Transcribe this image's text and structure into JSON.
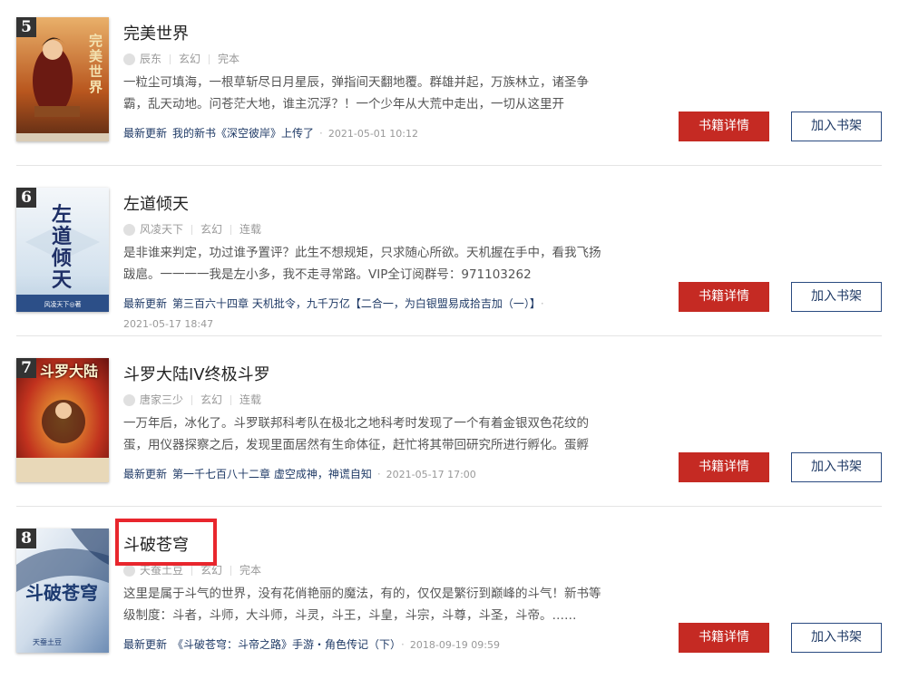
{
  "labels": {
    "update": "最新更新",
    "detail_button": "书籍详情",
    "shelf_button": "加入书架"
  },
  "books": [
    {
      "rank": "5",
      "title": "完美世界",
      "author": "辰东",
      "genre": "玄幻",
      "status": "完本",
      "desc": "一粒尘可填海，一根草斩尽日月星辰，弹指间天翻地覆。群雄并起，万族林立，诸圣争霸，乱天动地。问苍茫大地，谁主沉浮？！一个少年从大荒中走出，一切从这里开",
      "latest_chapter": "我的新书《深空彼岸》上传了",
      "update_time": "2021-05-01 10:12"
    },
    {
      "rank": "6",
      "title": "左道倾天",
      "author": "风凌天下",
      "genre": "玄幻",
      "status": "连载",
      "desc": "是非谁来判定，功过谁予置评？此生不想规矩，只求随心所欲。天机握在手中，看我飞扬跋扈。一一一一我是左小多，我不走寻常路。VIP全订阅群号：971103262",
      "latest_chapter": "第三百六十四章 天机批令，九千万亿【二合一，为白银盟易成拾吉加（一）】",
      "update_time": "2021-05-17 18:47"
    },
    {
      "rank": "7",
      "title": "斗罗大陆IV终极斗罗",
      "author": "唐家三少",
      "genre": "玄幻",
      "status": "连载",
      "desc": "一万年后，冰化了。斗罗联邦科考队在极北之地科考时发现了一个有着金银双色花纹的蛋，用仪器探察之后，发现里面居然有生命体征，赶忙将其带回研究所进行孵化。蛋孵",
      "latest_chapter": "第一千七百八十二章 虚空成神，神谎自知",
      "update_time": "2021-05-17 17:00"
    },
    {
      "rank": "8",
      "title": "斗破苍穹",
      "author": "天蚕土豆",
      "genre": "玄幻",
      "status": "完本",
      "desc": "这里是属于斗气的世界，没有花俏艳丽的魔法，有的，仅仅是繁衍到巅峰的斗气！新书等级制度：斗者，斗师，大斗师，斗灵，斗王，斗皇，斗宗，斗尊，斗圣，斗帝。……",
      "latest_chapter": "《斗破苍穹：斗帝之路》手游・角色传记（下）",
      "update_time": "2018-09-19 09:59"
    }
  ],
  "covers": [
    {
      "text": "完美世界",
      "text_color": "#e8d8a0",
      "bg": "#c56a2c"
    },
    {
      "text": "左道倾天",
      "text_color": "#1e2f66",
      "bg": "#dfe9f2",
      "caption": "风凌天下◎著"
    },
    {
      "text": "斗罗大陆",
      "text_color": "#f5e6c0",
      "bg": "#b8241c"
    },
    {
      "text": "斗破苍穹",
      "text_color": "#1c3a70",
      "bg": "#e6eef6",
      "caption": "天蚕土豆"
    }
  ]
}
